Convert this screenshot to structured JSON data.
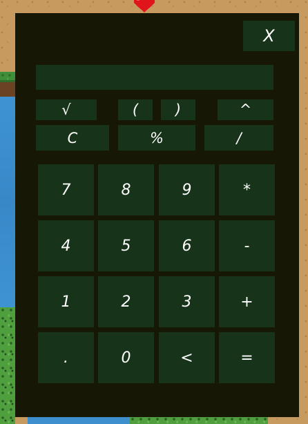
{
  "calculator": {
    "close_label": "X",
    "display_value": "",
    "function_row_1": [
      "√",
      "(",
      ")",
      "^"
    ],
    "function_row_2": [
      "C",
      "%",
      "/"
    ],
    "keypad": [
      [
        "7",
        "8",
        "9",
        "*"
      ],
      [
        "4",
        "5",
        "6",
        "-"
      ],
      [
        "1",
        "2",
        "3",
        "+"
      ],
      [
        ".",
        "0",
        "<",
        "="
      ]
    ]
  },
  "colors": {
    "panel_bg": "#161705",
    "button_bg": "#17341a",
    "text": "#ffffff",
    "sand": "#c79a5f",
    "water": "#3d8fce",
    "grass": "#4f9f3e",
    "heart": "#e0141b"
  }
}
